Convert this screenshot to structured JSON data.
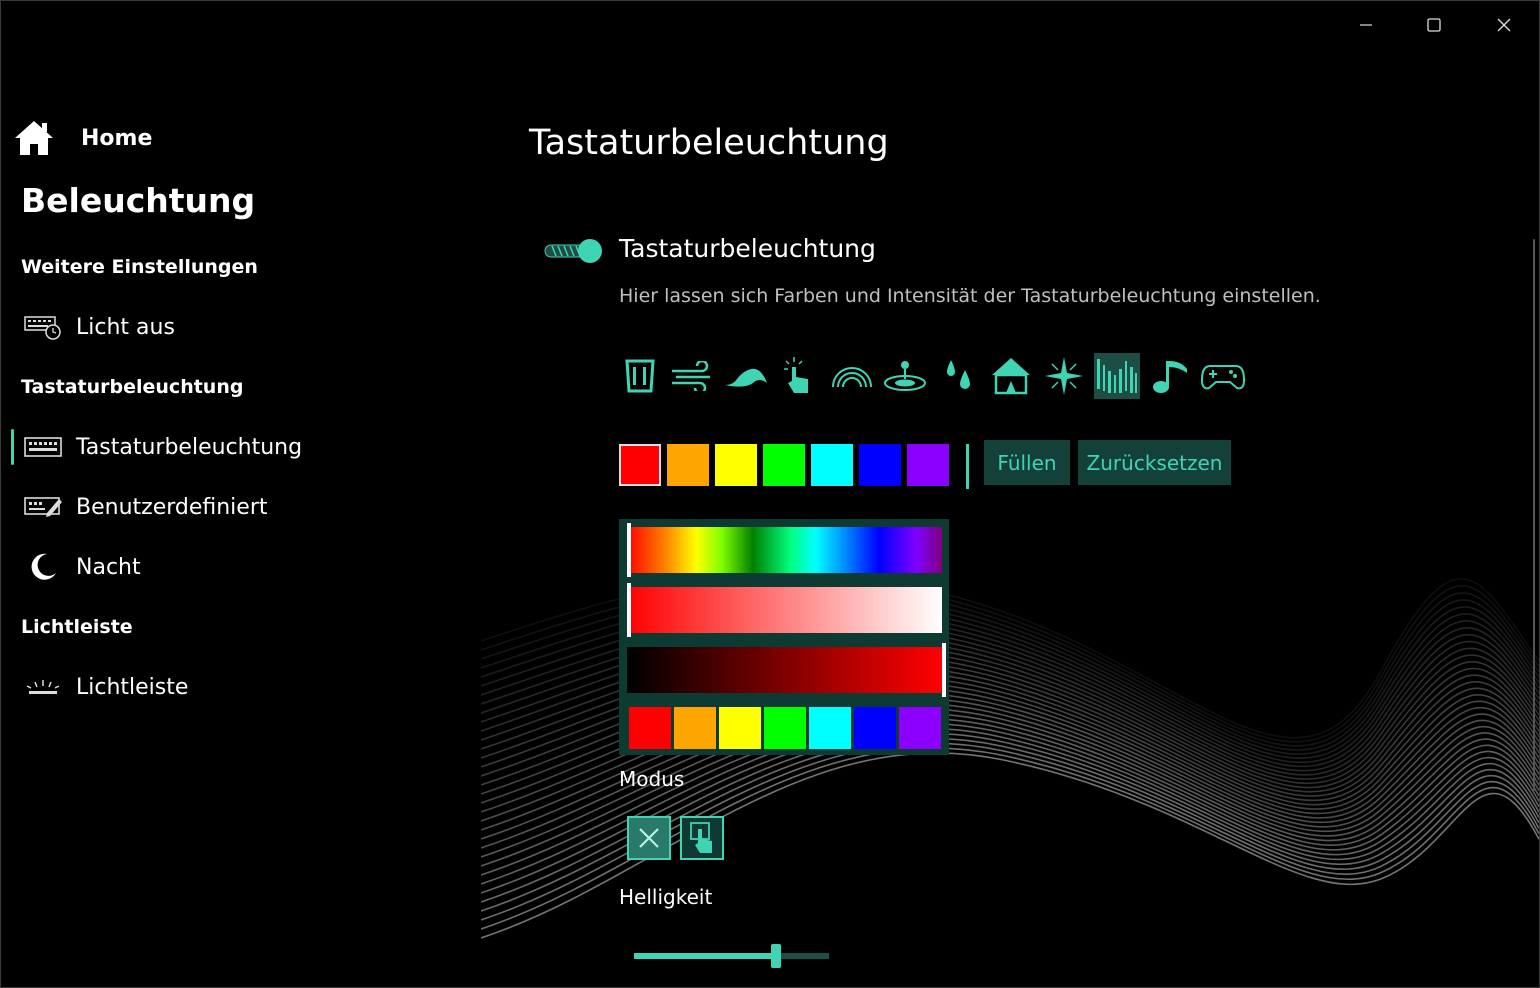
{
  "window": {
    "controls": [
      "minimize-icon",
      "maximize-icon",
      "close-icon"
    ]
  },
  "sidebar": {
    "home_label": "Home",
    "title": "Beleuchtung",
    "sections": [
      {
        "label": "Weitere Einstellungen",
        "items": [
          {
            "label": "Licht aus",
            "icon": "keyboard-timer-icon"
          }
        ]
      },
      {
        "label": "Tastaturbeleuchtung",
        "items": [
          {
            "label": "Tastaturbeleuchtung",
            "icon": "keyboard-icon",
            "selected": true
          },
          {
            "label": "Benutzerdefiniert",
            "icon": "keyboard-edit-icon"
          },
          {
            "label": "Nacht",
            "icon": "moon-icon"
          }
        ]
      },
      {
        "label": "Lichtleiste",
        "items": [
          {
            "label": "Lichtleiste",
            "icon": "light-bar-icon"
          }
        ]
      }
    ]
  },
  "main": {
    "page_title": "Tastaturbeleuchtung",
    "toggle": {
      "label": "Tastaturbeleuchtung",
      "on": true
    },
    "description": "Hier lassen sich Farben und Intensität der Tastaturbeleuchtung einstellen.",
    "effects": [
      "static-icon",
      "wind-icon",
      "wave-icon",
      "touch-icon",
      "rainbow-icon",
      "ripple-icon",
      "raindrop-icon",
      "circus-icon",
      "sparkle-icon",
      "aurora-icon",
      "music-icon",
      "gamepad-icon"
    ],
    "active_effect": "aurora-icon",
    "swatches": [
      "#ff0000",
      "#ffa500",
      "#ffff00",
      "#00ff00",
      "#00ffff",
      "#0000ff",
      "#8b00ff"
    ],
    "selected_swatch": 0,
    "fill_button": "Füllen",
    "reset_button": "Zurücksetzen",
    "picker": {
      "hue": 0,
      "saturation": 1,
      "value": 1,
      "mini_swatches": [
        "#ff0000",
        "#ffa500",
        "#ffff00",
        "#00ff00",
        "#00ffff",
        "#0000ff",
        "#8b00ff"
      ]
    },
    "mode_label": "Modus",
    "modes": [
      "close-mode-icon",
      "touch-mode-icon"
    ],
    "brightness_label": "Helligkeit",
    "brightness": 0.73
  },
  "colors": {
    "accent": "#3fd4b4",
    "accent_dark": "#134039",
    "panel": "#0d3b34"
  }
}
